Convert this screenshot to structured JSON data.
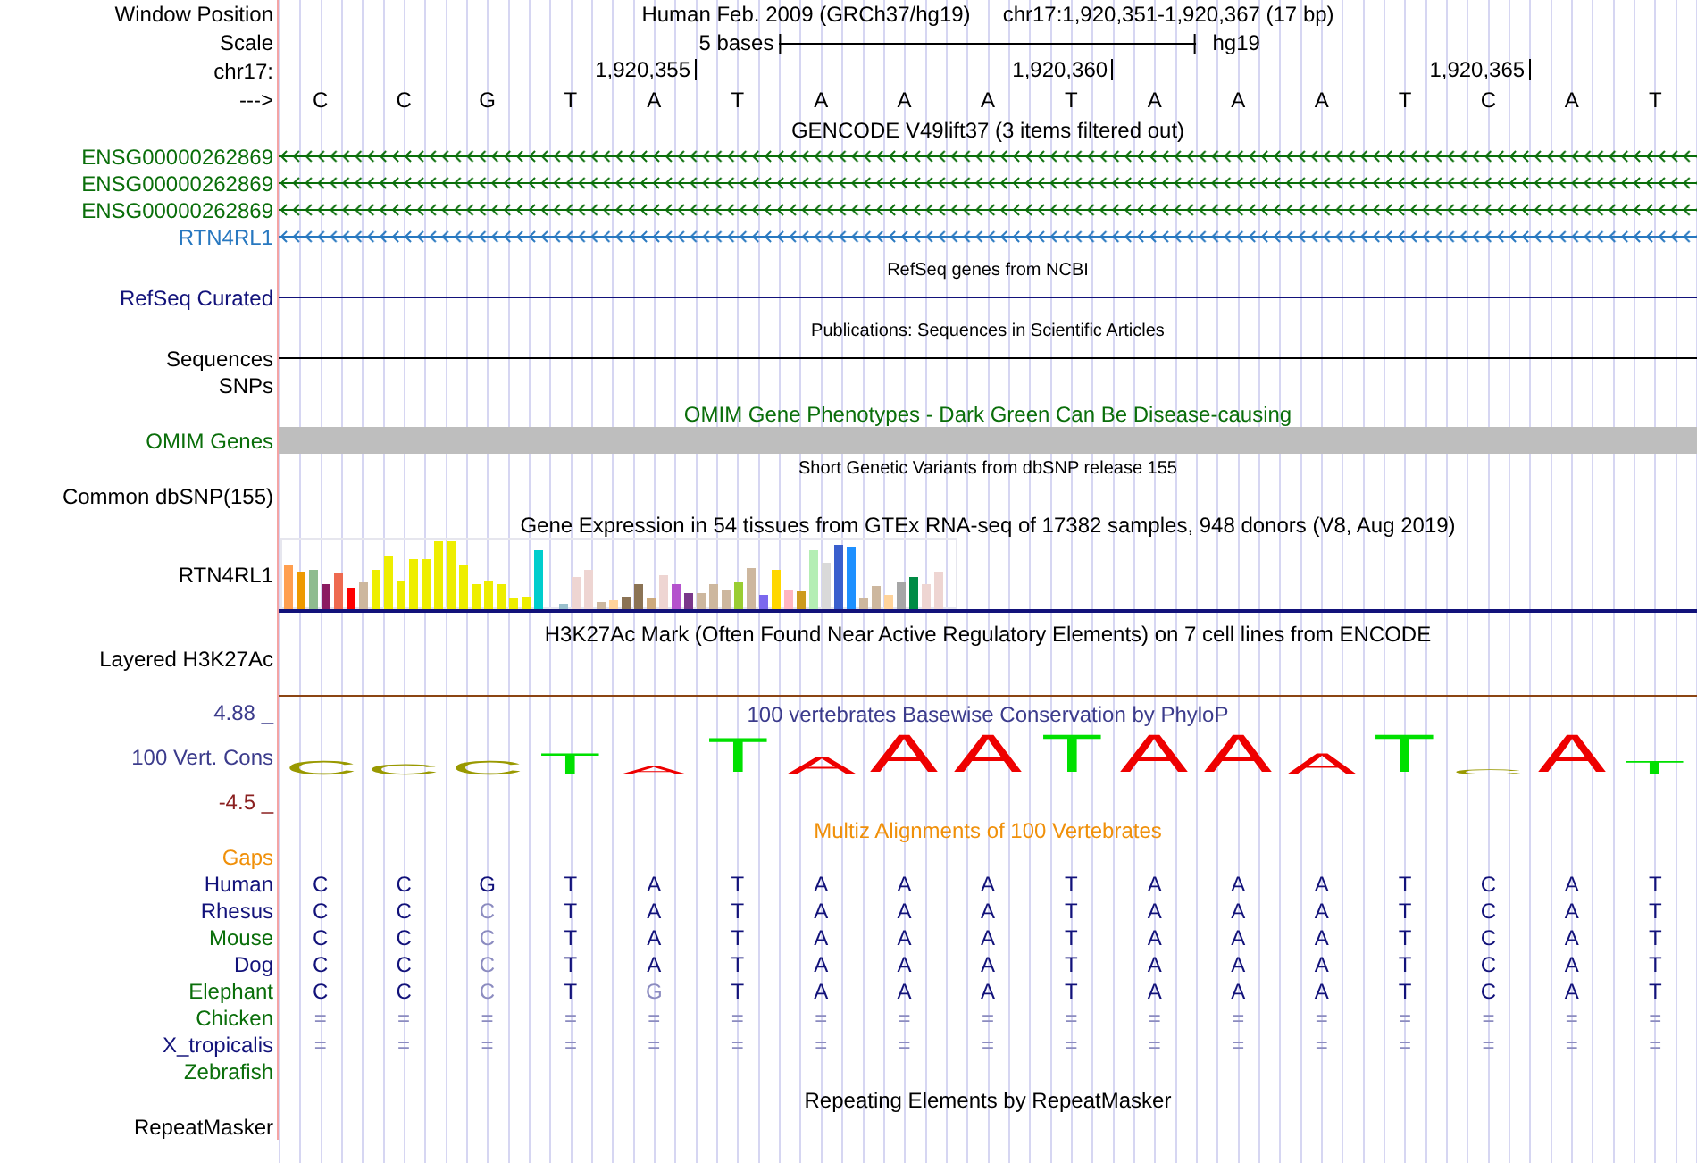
{
  "position": {
    "label": "Window Position",
    "assembly": "Human Feb. 2009 (GRCh37/hg19)",
    "range": "chr17:1,920,351-1,920,367 (17 bp)"
  },
  "scale": {
    "label": "Scale",
    "length": "5 bases",
    "assembly": "hg19"
  },
  "ruler": {
    "label": "chr17:",
    "ticks": [
      "1,920,355",
      "1,920,360",
      "1,920,365"
    ]
  },
  "sequence": {
    "label": "--->",
    "bases": [
      "C",
      "C",
      "G",
      "T",
      "A",
      "T",
      "A",
      "A",
      "A",
      "T",
      "A",
      "A",
      "A",
      "T",
      "C",
      "A",
      "T"
    ]
  },
  "tracks": [
    {
      "kind": "genes",
      "title": {
        "text": "GENCODE V49lift37 (3 items filtered out)",
        "kind": "major"
      },
      "items": [
        {
          "label": "ENSG00000262869",
          "color": "#0a6e0a"
        },
        {
          "label": "ENSG00000262869",
          "color": "#0a6e0a"
        },
        {
          "label": "ENSG00000262869",
          "color": "#0a6e0a"
        },
        {
          "label": "RTN4RL1",
          "color": "#2878c0"
        }
      ]
    },
    {
      "kind": "line",
      "title": {
        "text": "RefSeq genes from NCBI",
        "kind": "minor"
      },
      "label": "RefSeq Curated",
      "color": "#12127a"
    },
    {
      "kind": "line",
      "title": {
        "text": "Publications: Sequences in Scientific Articles",
        "kind": "minor"
      },
      "label": "Sequences",
      "color": "#000000"
    },
    {
      "kind": "empty",
      "label": "SNPs",
      "color": "#000000"
    },
    {
      "kind": "bar",
      "title": {
        "text": "OMIM Gene Phenotypes - Dark Green Can Be Disease-causing",
        "kind": "major"
      },
      "label": "OMIM Genes",
      "color": "#0a6e0a"
    },
    {
      "kind": "empty",
      "title": {
        "text": "Short Genetic Variants from dbSNP release 155",
        "kind": "minor"
      },
      "label": "Common dbSNP(155)",
      "color": "#000000"
    },
    {
      "kind": "expression",
      "title": {
        "text": "Gene Expression in 54 tissues from GTEx RNA-seq of 17382 samples, 948 donors (V8, Aug 2019)",
        "kind": "major"
      },
      "label": "RTN4RL1",
      "color": "#000000"
    },
    {
      "kind": "layered",
      "title": {
        "text": "H3K27Ac Mark (Often Found Near Active Regulatory Elements) on 7 cell lines from ENCODE",
        "kind": "major"
      },
      "label": "Layered H3K27Ac",
      "color": "#000000"
    },
    {
      "kind": "logo",
      "title": {
        "text": "100 vertebrates Basewise Conservation by PhyloP",
        "kind": "major"
      },
      "label": "100 Vert. Cons",
      "color": "#3c3c8c",
      "max": "4.88 _",
      "min": "-4.5 _",
      "letters": [
        {
          "base": "C",
          "color": "#999900"
        },
        {
          "base": "C",
          "color": "#999900"
        },
        {
          "base": "C",
          "color": "#999900"
        },
        {
          "base": "T",
          "color": "#00e000"
        },
        {
          "base": "A",
          "color": "#ee0000"
        },
        {
          "base": "T",
          "color": "#00e000"
        },
        {
          "base": "A",
          "color": "#ee0000"
        },
        {
          "base": "A",
          "color": "#ee0000"
        },
        {
          "base": "A",
          "color": "#ee0000"
        },
        {
          "base": "T",
          "color": "#00e000"
        },
        {
          "base": "A",
          "color": "#ee0000"
        },
        {
          "base": "A",
          "color": "#ee0000"
        },
        {
          "base": "A",
          "color": "#ee0000"
        },
        {
          "base": "T",
          "color": "#00e000"
        },
        {
          "base": "C",
          "color": "#999900"
        },
        {
          "base": "A",
          "color": "#ee0000"
        },
        {
          "base": "T",
          "color": "#00e000"
        }
      ]
    },
    {
      "kind": "alignment",
      "title": {
        "text": "Multiz Alignments of 100 Vertebrates",
        "kind": "major"
      },
      "label": "Gaps",
      "color": "#f0900a",
      "species": [
        {
          "name": "Human",
          "color": "#12127a",
          "bases": [
            "C",
            "C",
            "G",
            "T",
            "A",
            "T",
            "A",
            "A",
            "A",
            "T",
            "A",
            "A",
            "A",
            "T",
            "C",
            "A",
            "T"
          ],
          "faded": [
            false,
            false,
            false,
            false,
            false,
            false,
            false,
            false,
            false,
            false,
            false,
            false,
            false,
            false,
            false,
            false,
            false
          ]
        },
        {
          "name": "Rhesus",
          "color": "#12127a",
          "bases": [
            "C",
            "C",
            "C",
            "T",
            "A",
            "T",
            "A",
            "A",
            "A",
            "T",
            "A",
            "A",
            "A",
            "T",
            "C",
            "A",
            "T"
          ],
          "faded": [
            false,
            false,
            true,
            false,
            false,
            false,
            false,
            false,
            false,
            false,
            false,
            false,
            false,
            false,
            false,
            false,
            false
          ]
        },
        {
          "name": "Mouse",
          "color": "#0a6e0a",
          "bases": [
            "C",
            "C",
            "C",
            "T",
            "A",
            "T",
            "A",
            "A",
            "A",
            "T",
            "A",
            "A",
            "A",
            "T",
            "C",
            "A",
            "T"
          ],
          "faded": [
            false,
            false,
            true,
            false,
            false,
            false,
            false,
            false,
            false,
            false,
            false,
            false,
            false,
            false,
            false,
            false,
            false
          ]
        },
        {
          "name": "Dog",
          "color": "#12127a",
          "bases": [
            "C",
            "C",
            "C",
            "T",
            "A",
            "T",
            "A",
            "A",
            "A",
            "T",
            "A",
            "A",
            "A",
            "T",
            "C",
            "A",
            "T"
          ],
          "faded": [
            false,
            false,
            true,
            false,
            false,
            false,
            false,
            false,
            false,
            false,
            false,
            false,
            false,
            false,
            false,
            false,
            false
          ]
        },
        {
          "name": "Elephant",
          "color": "#0a6e0a",
          "bases": [
            "C",
            "C",
            "C",
            "T",
            "G",
            "T",
            "A",
            "A",
            "A",
            "T",
            "A",
            "A",
            "A",
            "T",
            "C",
            "A",
            "T"
          ],
          "faded": [
            false,
            false,
            true,
            false,
            true,
            false,
            false,
            false,
            false,
            false,
            false,
            false,
            false,
            false,
            false,
            false,
            false
          ]
        },
        {
          "name": "Chicken",
          "color": "#0a6e0a",
          "bases": [
            "=",
            "=",
            "=",
            "=",
            "=",
            "=",
            "=",
            "=",
            "=",
            "=",
            "=",
            "=",
            "=",
            "=",
            "=",
            "=",
            "="
          ],
          "faded": [
            true,
            true,
            true,
            true,
            true,
            true,
            true,
            true,
            true,
            true,
            true,
            true,
            true,
            true,
            true,
            true,
            true
          ]
        },
        {
          "name": "X_tropicalis",
          "color": "#12127a",
          "bases": [
            "=",
            "=",
            "=",
            "=",
            "=",
            "=",
            "=",
            "=",
            "=",
            "=",
            "=",
            "=",
            "=",
            "=",
            "=",
            "=",
            "="
          ],
          "faded": [
            true,
            true,
            true,
            true,
            true,
            true,
            true,
            true,
            true,
            true,
            true,
            true,
            true,
            true,
            true,
            true,
            true
          ]
        },
        {
          "name": "Zebrafish",
          "color": "#0a6e0a"
        }
      ]
    },
    {
      "kind": "empty",
      "title": {
        "text": "Repeating Elements by RepeatMasker",
        "kind": "major"
      },
      "label": "RepeatMasker",
      "color": "#000000"
    }
  ]
}
